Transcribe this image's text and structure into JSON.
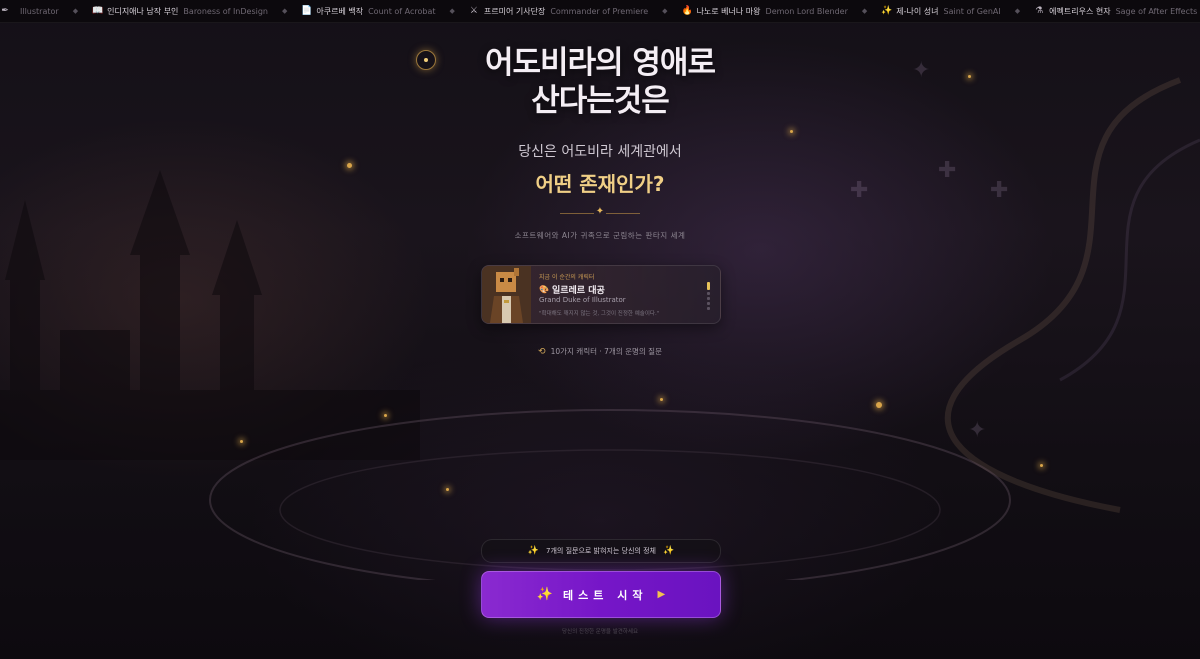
{
  "ticker": {
    "items": [
      {
        "icon": "pen-icon",
        "glyph": "✒",
        "ko": "",
        "en": "Illustrator"
      },
      {
        "icon": "book-icon",
        "glyph": "📖",
        "ko": "인디지애나 남작 부인",
        "en": "Baroness of InDesign"
      },
      {
        "icon": "document-icon",
        "glyph": "📄",
        "ko": "아쿠르베 백작",
        "en": "Count of Acrobat"
      },
      {
        "icon": "crossed-swords-icon",
        "glyph": "⚔",
        "ko": "프르미어 기사단장",
        "en": "Commander of Premiere"
      },
      {
        "icon": "flame-icon",
        "glyph": "🔥",
        "ko": "나노로 베너나 마왕",
        "en": "Demon Lord Blender"
      },
      {
        "icon": "sparkle-icon",
        "glyph": "✨",
        "ko": "제-나이 성녀",
        "en": "Saint of GenAI"
      },
      {
        "icon": "potion-icon",
        "glyph": "⚗",
        "ko": "에펙트리우스 현자",
        "en": "Sage of After Effects"
      }
    ]
  },
  "hero": {
    "title_line1": "어도비라의 영애로",
    "title_line2": "산다는것은",
    "subtitle": "당신은 어도비라 세계관에서",
    "question": "어떤 존재인가?",
    "tagline": "소프트웨어와 AI가 귀족으로 군림하는 판타지 세계"
  },
  "card": {
    "label": "지금 이 순간의 캐릭터",
    "icon": "palette-icon",
    "name": "일르레르 대공",
    "name_en": "Grand Duke of Illustrator",
    "quote": "\"확대해도 깨지지 않는 것, 그것이 진정한 예술이다.\""
  },
  "meta": {
    "icon": "cycle-icon",
    "text": "10가지 캐릭터 · 7개의 운명의 질문"
  },
  "bottom": {
    "pill_text": "7개의 질문으로 밝혀지는 당신의 정체",
    "start_label": "테스트 시작",
    "footnote": "당신의 진정한 운명을 발견하세요"
  },
  "colors": {
    "accent_gold": "#f0cf86",
    "button_purple": "#7616c8",
    "background": "#0f0b12"
  }
}
